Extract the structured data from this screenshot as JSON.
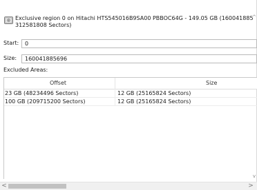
{
  "header": {
    "line1": "Exclusive region 0 on Hitachi HTS545016B9SA00 PBBOC64G - 149.05 GB (160041885696",
    "line2": "312581808 Sectors)",
    "icon": "disk-icon"
  },
  "fields": {
    "start_label": "Start:",
    "start_value": "0",
    "size_label": "Size:",
    "size_value": "160041885696"
  },
  "excluded": {
    "label": "Excluded Areas:",
    "columns": [
      "Offset",
      "Size"
    ],
    "rows": [
      {
        "offset": "23 GB (48234496 Sectors)",
        "size": "12 GB (25165824 Sectors)"
      },
      {
        "offset": "100 GB (209715200 Sectors)",
        "size": "12 GB (25165824 Sectors)"
      }
    ]
  },
  "scrollbar": {
    "left_arrow": "<",
    "right_arrow": ">",
    "up_arrow": "^",
    "down_arrow": "v"
  }
}
